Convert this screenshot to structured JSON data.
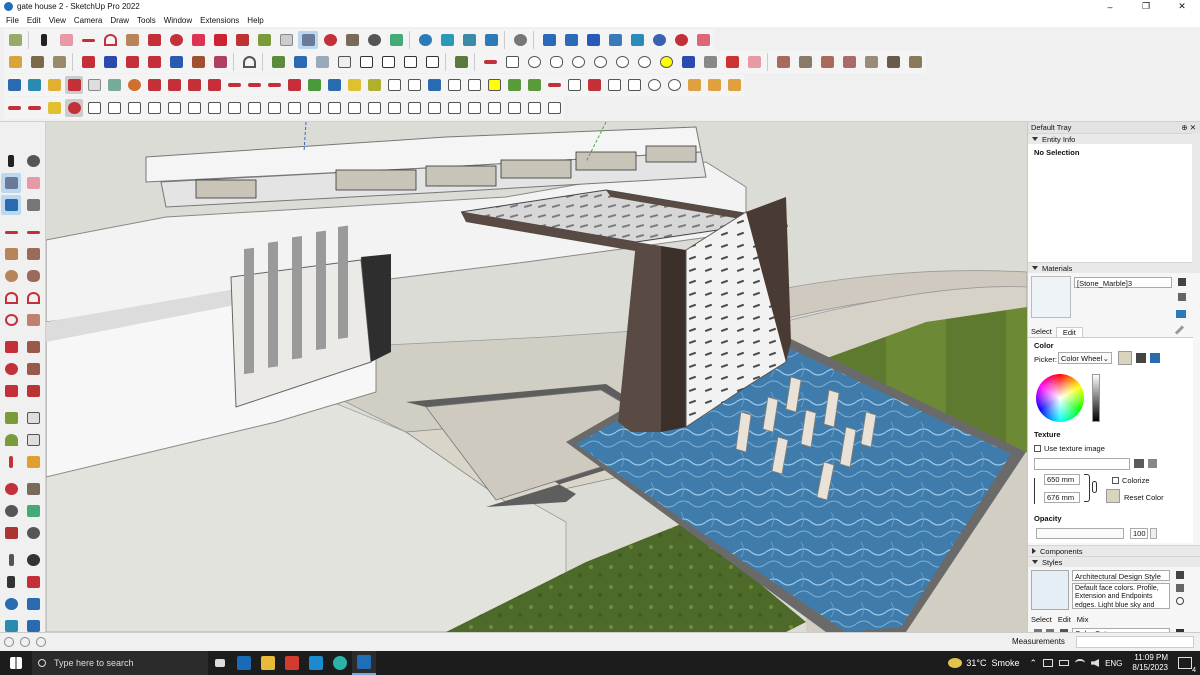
{
  "window": {
    "title": "gate house 2 - SketchUp Pro 2022",
    "controls": [
      "–",
      "❐",
      "✕"
    ]
  },
  "menu": [
    "File",
    "Edit",
    "View",
    "Camera",
    "Draw",
    "Tools",
    "Window",
    "Extensions",
    "Help"
  ],
  "tray": {
    "title": "Default Tray",
    "title_ctl": "⊕ ✕",
    "entity_info": {
      "header": "Entity Info",
      "selection": "No Selection"
    },
    "materials": {
      "header": "Materials",
      "name": "[Stone_Marble]3",
      "tabs": [
        "Select",
        "Edit"
      ],
      "color_label": "Color",
      "picker_label": "Picker:",
      "picker_value": "Color Wheel",
      "texture_label": "Texture",
      "use_texture": "Use texture image",
      "width": "650 mm",
      "height": "676 mm",
      "colorize": "Colorize",
      "reset_color": "Reset Color",
      "opacity_label": "Opacity",
      "opacity_value": "100"
    },
    "components": {
      "header": "Components"
    },
    "styles": {
      "header": "Styles",
      "name": "Architectural Design Style",
      "description": "Default face colors. Profile, Extension and Endpoints edges. Light blue sky and gray",
      "tabs": [
        "Select",
        "Edit",
        "Mix"
      ],
      "set_value": "Color Sets"
    }
  },
  "statusbar": {
    "measurements_label": "Measurements"
  },
  "taskbar": {
    "search_placeholder": "Type here to search",
    "weather": "31°C  Smoke",
    "language": "ENG",
    "time": "11:09 PM",
    "date": "8/15/2023",
    "notifications": "4"
  },
  "colors": {
    "accent": "#1f6fb8",
    "water": "#3f7cab",
    "grass": "#5d7a2e",
    "gate_frame": "#5a4a44",
    "taskbar": "#1c1c1c"
  }
}
